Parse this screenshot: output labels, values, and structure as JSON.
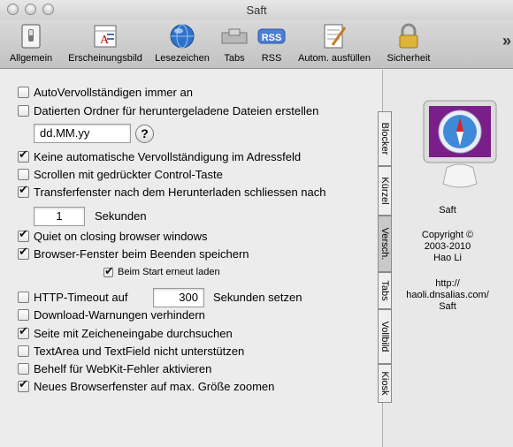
{
  "window": {
    "title": "Saft"
  },
  "toolbar": {
    "items": [
      {
        "label": "Allgemein",
        "icon": "switch-icon"
      },
      {
        "label": "Erscheinungsbild",
        "icon": "appearance-icon"
      },
      {
        "label": "Lesezeichen",
        "icon": "globe-icon"
      },
      {
        "label": "Tabs",
        "icon": "tabs-icon"
      },
      {
        "label": "RSS",
        "icon": "rss-icon"
      },
      {
        "label": "Autom. ausfüllen",
        "icon": "autofill-icon"
      },
      {
        "label": "Sicherheit",
        "icon": "lock-icon"
      }
    ],
    "overflow": "»",
    "rss_badge": "RSS"
  },
  "options": {
    "autocomplete": {
      "label": "AutoVervollständigen immer an",
      "checked": false
    },
    "dated_folder": {
      "label": "Datierten Ordner für heruntergeladene Dateien erstellen",
      "checked": false
    },
    "date_format": {
      "value": "dd.MM.yy"
    },
    "help": "?",
    "no_auto_complete": {
      "label": "Keine automatische Vervollständigung im Adressfeld",
      "checked": true
    },
    "scroll_ctrl": {
      "label": "Scrollen mit gedrückter Control-Taste",
      "checked": false
    },
    "close_transfer": {
      "label": "Transferfenster nach dem Herunterladen schliessen nach",
      "checked": true
    },
    "seconds_value": "1",
    "seconds_label": "Sekunden",
    "quiet_closing": {
      "label": "Quiet on closing browser windows",
      "checked": true
    },
    "save_windows": {
      "label": "Browser-Fenster beim Beenden speichern",
      "checked": true
    },
    "reload_start": {
      "label": "Beim Start erneut laden",
      "checked": true
    },
    "http_timeout": {
      "label": "HTTP-Timeout auf",
      "checked": false,
      "value": "300",
      "suffix": "Sekunden setzen"
    },
    "download_warn": {
      "label": "Download-Warnungen verhindern",
      "checked": false
    },
    "search_typing": {
      "label": "Seite mit Zeicheneingabe durchsuchen",
      "checked": true
    },
    "textarea": {
      "label": "TextArea und TextField nicht unterstützen",
      "checked": false
    },
    "webkit_fix": {
      "label": "Behelf für WebKit-Fehler aktivieren",
      "checked": false
    },
    "max_zoom": {
      "label": "Neues Browserfenster auf max. Größe zoomen",
      "checked": true
    }
  },
  "vertical_tabs": [
    "Blocker",
    "Kürzel",
    "Versch.",
    "Tabs",
    "Vollbild",
    "Kiosk"
  ],
  "active_tab": "Versch.",
  "about": {
    "app_name": "Saft",
    "copyright": "Copyright ©",
    "years": "2003-2010",
    "author": "Hao Li",
    "url_line1": "http://",
    "url_line2": "haoli.dnsalias.com/",
    "url_line3": "Saft"
  }
}
